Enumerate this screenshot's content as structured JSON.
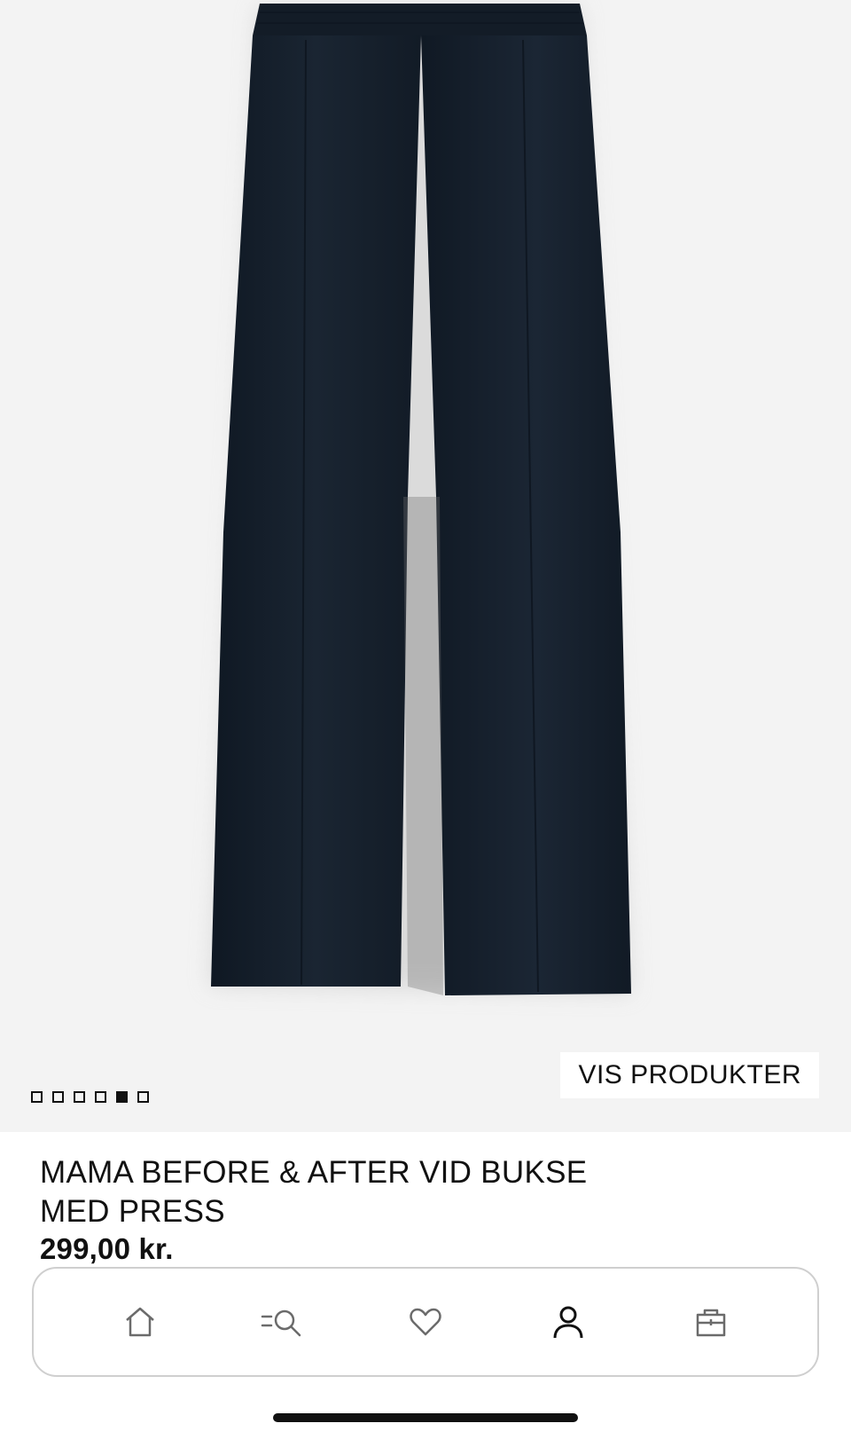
{
  "product": {
    "title_line1": "MAMA BEFORE & AFTER VID BUKSE",
    "title_line2": "MED PRESS",
    "price": "299,00 kr.",
    "color": "#16202c"
  },
  "gallery": {
    "total_images": 6,
    "active_index": 4,
    "show_products_label": "VIS PRODUKTER"
  },
  "nav": {
    "items": [
      {
        "icon": "home-icon"
      },
      {
        "icon": "search-menu-icon"
      },
      {
        "icon": "heart-icon"
      },
      {
        "icon": "account-icon"
      },
      {
        "icon": "shopping-bag-icon"
      }
    ]
  },
  "colors": {
    "background": "#f3f3f3",
    "text": "#111111",
    "nav_border": "#cfcfcf"
  }
}
